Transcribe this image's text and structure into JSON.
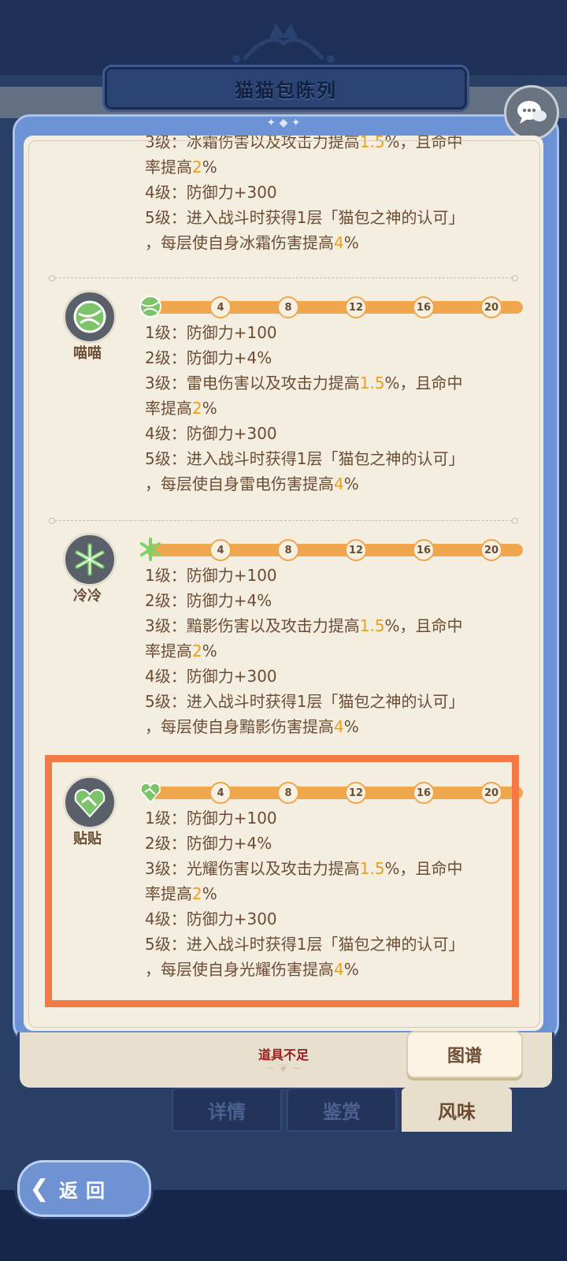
{
  "header": {
    "title": "猫猫包陈列"
  },
  "top_partial": {
    "lines": [
      [
        "3级：冰霜伤害以及攻击力提高",
        "1.5",
        "%，且命中"
      ],
      [
        "率提高",
        "2",
        "%"
      ],
      [
        "4级：防御力+300",
        "",
        ""
      ],
      [
        "5级：进入战斗时获得1层「猫包之神的认可」",
        "",
        ""
      ],
      [
        "，每层使自身冰霜伤害提高",
        "4",
        "%"
      ]
    ]
  },
  "ticks": [
    "4",
    "8",
    "12",
    "16",
    "20"
  ],
  "sections": [
    {
      "name": "喵喵",
      "icon": "green-ball-icon",
      "lines": [
        [
          "1级：防御力+100",
          "",
          ""
        ],
        [
          "2级：防御力+4%",
          "",
          ""
        ],
        [
          "3级：雷电伤害以及攻击力提高",
          "1.5",
          "%，且命中"
        ],
        [
          "率提高",
          "2",
          "%"
        ],
        [
          "4级：防御力+300",
          "",
          ""
        ],
        [
          "5级：进入战斗时获得1层「猫包之神的认可」",
          "",
          ""
        ],
        [
          "，每层使自身雷电伤害提高",
          "4",
          "%"
        ]
      ]
    },
    {
      "name": "冷冷",
      "icon": "snowflake-icon",
      "lines": [
        [
          "1级：防御力+100",
          "",
          ""
        ],
        [
          "2级：防御力+4%",
          "",
          ""
        ],
        [
          "3级：黯影伤害以及攻击力提高",
          "1.5",
          "%，且命中"
        ],
        [
          "率提高",
          "2",
          "%"
        ],
        [
          "4级：防御力+300",
          "",
          ""
        ],
        [
          "5级：进入战斗时获得1层「猫包之神的认可」",
          "",
          ""
        ],
        [
          "，每层使自身黯影伤害提高",
          "4",
          "%"
        ]
      ]
    },
    {
      "name": "贴贴",
      "icon": "handshake-heart-icon",
      "lines": [
        [
          "1级：防御力+100",
          "",
          ""
        ],
        [
          "2级：防御力+4%",
          "",
          ""
        ],
        [
          "3级：光耀伤害以及攻击力提高",
          "1.5",
          "%，且命中"
        ],
        [
          "率提高",
          "2",
          "%"
        ],
        [
          "4级：防御力+300",
          "",
          ""
        ],
        [
          "5级：进入战斗时获得1层「猫包之神的认可」",
          "",
          ""
        ],
        [
          "，每层使自身光耀伤害提高",
          "4",
          "%"
        ]
      ]
    }
  ],
  "bottom": {
    "message": "道具不足",
    "tujian": "图谱"
  },
  "tabs": [
    {
      "label": "详情",
      "active": false
    },
    {
      "label": "鉴赏",
      "active": false
    },
    {
      "label": "风味",
      "active": true
    }
  ],
  "back": {
    "label": "返回"
  },
  "colors": {
    "highlight": "#e8a020",
    "bar": "#efa64c",
    "selection": "#f47a45",
    "text": "#6b4d34"
  }
}
